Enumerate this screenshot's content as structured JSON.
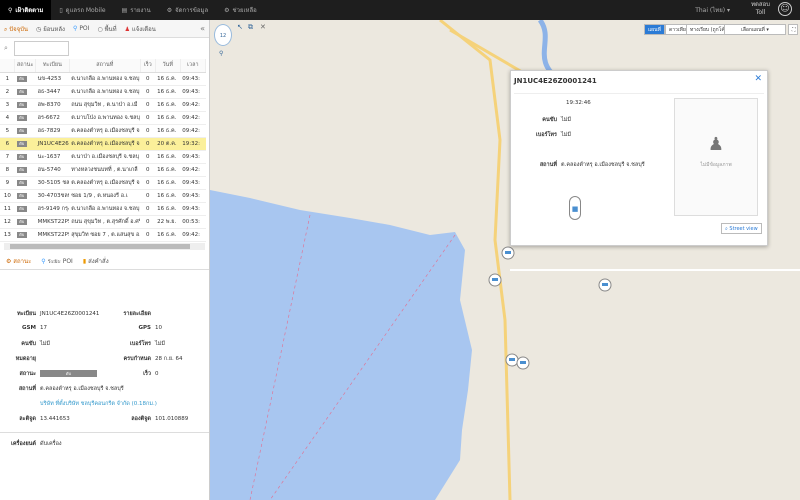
{
  "topbar": {
    "items": [
      {
        "label": "เฝ้าติดตาม",
        "icon": "map-pin-icon"
      },
      {
        "label": "ดูแลรถ Mobile",
        "icon": "mobile-icon"
      },
      {
        "label": "รายงาน",
        "icon": "report-icon"
      },
      {
        "label": "จัดการข้อมูล",
        "icon": "gear-icon"
      },
      {
        "label": "ช่วยเหลือ",
        "icon": "help-icon"
      }
    ],
    "language": "Thai (ไทย)",
    "user": "Toll",
    "user_line1": "ทดสอบ"
  },
  "left_tabs": [
    "ปัจจุบัน",
    "ย้อนหลัง",
    "POI",
    "พื้นที่",
    "แจ้งเตือน"
  ],
  "search": {
    "placeholder": ""
  },
  "table": {
    "headers": [
      "",
      "สถานะ",
      "ทะเบียน",
      "สถานที่",
      "เร็ว",
      "วันที่",
      "เวลา"
    ],
    "rows": [
      [
        "1",
        "ดับ",
        "นข-4253",
        "ต.นาเกลือ อ.พานทอง จ.ชลบุ",
        "0",
        "16 ธ.ค.",
        "09:43:"
      ],
      [
        "2",
        "ดับ",
        "ฮธ-3447",
        "ต.นาเกลือ อ.พานทอง จ.ชลบุ",
        "0",
        "16 ธ.ค.",
        "09:43:"
      ],
      [
        "3",
        "ดับ",
        "ฮพ-8370",
        "ถนน สุขุมวิท , ต.นาป่า อ.เมื",
        "0",
        "16 ธ.ค.",
        "09:42:"
      ],
      [
        "4",
        "ดับ",
        "ฮร-6672",
        "ต.มาบโป่ง อ.พานทอง จ.ชลบุ",
        "0",
        "16 ธ.ค.",
        "09:42:"
      ],
      [
        "5",
        "ดับ",
        "ฮธ-7829",
        "ต.คลองตำหรุ อ.เมืองชลบุรี จ.",
        "0",
        "16 ธ.ค.",
        "09:42:"
      ],
      [
        "6",
        "ดับ",
        "JN1UC4E26Z",
        "ต.คลองตำหรุ อ.เมืองชลบุรี จ.",
        "0",
        "20 ต.ค.",
        "19:32:"
      ],
      [
        "7",
        "ดับ",
        "นะ-1637",
        "ต.นาป่า อ.เมืองชลบุรี จ.ชลบุ",
        "0",
        "16 ธ.ค.",
        "09:43:"
      ],
      [
        "8",
        "ดับ",
        "ฮน-5740",
        "ทางหลวงชนบทที่ , ต.นาเกลื",
        "0",
        "16 ธ.ค.",
        "09:42:"
      ],
      [
        "9",
        "ดับ",
        "30-5105 ชล",
        "ต.คลองตำหรุ อ.เมืองชลบุรี จ.",
        "0",
        "16 ธ.ค.",
        "09:43:"
      ],
      [
        "10",
        "ดับ",
        "30-4703ชลบุรี",
        "ซอย 1/9 , ต.หนองรี อ.เ",
        "0",
        "16 ธ.ค.",
        "09:43:"
      ],
      [
        "11",
        "ดับ",
        "ฮร-9149 กรุง",
        "ต.นาเกลือ อ.พานทอง จ.ชลบุ",
        "0",
        "16 ธ.ค.",
        "09:43:"
      ],
      [
        "12",
        "ดับ",
        "MMKST22P5(",
        "ถนน สุขุมวิท , ต.สุรศักดิ์ อ.ศรี",
        "0",
        "22 พ.ย.",
        "00:53:"
      ],
      [
        "13",
        "ดับ",
        "MMKST22P9(",
        "สุขุมวิท ซอย 7 , ต.แสนสุข อ.",
        "0",
        "16 ธ.ค.",
        "09:42:"
      ]
    ]
  },
  "detail": {
    "tabs": [
      "สถานะ",
      "ระยะ POI",
      "ส่งคำสั่ง"
    ],
    "plate_label": "ทะเบียน",
    "plate": "JN1UC4E26Z0001241",
    "more_label": "รายละเอียด",
    "gsm_label": "GSM",
    "gsm": "17",
    "gps_label": "GPS",
    "gps": "10",
    "driver_label": "คนขับ",
    "driver": "ไม่มี",
    "phone_label": "เบอร์โทร",
    "phone": "ไม่มี",
    "expire_label": "หมดอายุ",
    "due_label": "ครบกำหนด",
    "due": "28 ก.ย. 64",
    "status_label": "สถานะ",
    "status": "ดับ",
    "status_fill": 100,
    "speed_label": "เร็ว",
    "speed": "0",
    "place_label": "สถานที่",
    "place": "ต.คลองตำหรุ อ.เมืองชลบุรี จ.ชลบุรี",
    "poi_link": "บริษัท ที่ตั้งบริษัท ชลบุรีคอนกรีต จำกัด (0.18กม.)",
    "lat_label": "ละติจูด",
    "lat": "13.441653",
    "lon_label": "ลองติจูด",
    "lon": "101.010889",
    "device_label": "เครื่องยนต์",
    "device": "ดับเครื่อง"
  },
  "map": {
    "zoom": "12",
    "type_buttons": [
      "แผนที่",
      "ดาวเทียม",
      "ทางเรียบ (ถูกโค้ง)"
    ],
    "select": "เลือกแผนที่",
    "active_type": "แผนที่",
    "sea_color": "#a8c6f0"
  },
  "popup": {
    "title": "JN1UC4E26Z0001241",
    "time": "19:32:46",
    "driver_label": "คนขับ",
    "driver": "ไม่มี",
    "phone_label": "เบอร์โทร",
    "phone": "ไม่มี",
    "place_label": "สถานที่",
    "place": "ต.คลองตำหรุ อ.เมืองชลบุรี จ.ชลบุรี",
    "image_caption": "ไม่มีข้อมูลภาพ",
    "street_view": "Street view"
  }
}
